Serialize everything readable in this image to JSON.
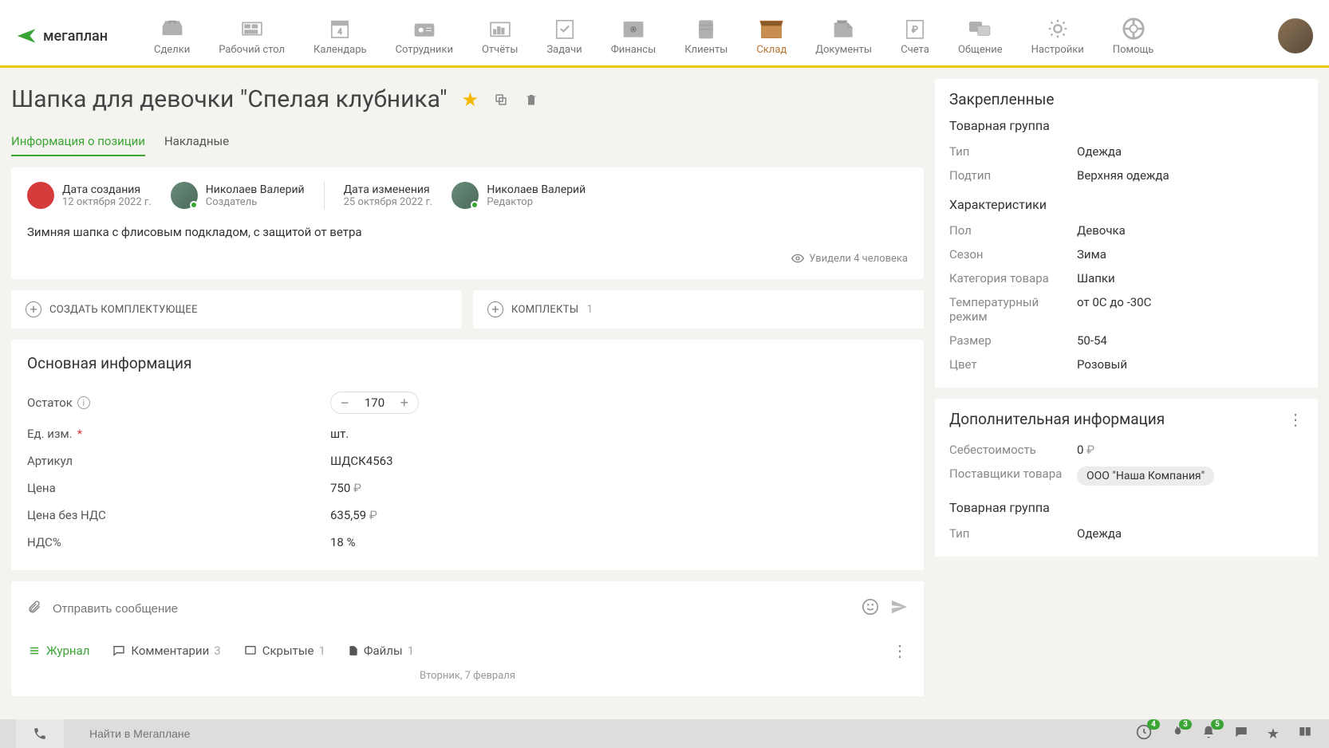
{
  "logo": "мегаплан",
  "nav": [
    {
      "label": "Сделки"
    },
    {
      "label": "Рабочий стол"
    },
    {
      "label": "Календарь"
    },
    {
      "label": "Сотрудники"
    },
    {
      "label": "Отчёты"
    },
    {
      "label": "Задачи"
    },
    {
      "label": "Финансы"
    },
    {
      "label": "Клиенты"
    },
    {
      "label": "Склад",
      "active": true
    },
    {
      "label": "Документы"
    },
    {
      "label": "Счета"
    },
    {
      "label": "Общение"
    },
    {
      "label": "Настройки"
    },
    {
      "label": "Помощь"
    }
  ],
  "page": {
    "title": "Шапка для девочки \"Спелая клубника\"",
    "tabs": [
      {
        "label": "Информация о позиции",
        "active": true
      },
      {
        "label": "Накладные"
      }
    ]
  },
  "meta": {
    "created_label": "Дата создания",
    "created_date": "12 октября 2022 г.",
    "creator_name": "Николаев Валерий",
    "creator_role": "Создатель",
    "modified_label": "Дата изменения",
    "modified_date": "25 октября 2022 г.",
    "editor_name": "Николаев Валерий",
    "editor_role": "Редактор",
    "description": "Зимняя шапка с флисовым подкладом, с защитой от ветра",
    "views": "Увидели 4 человека"
  },
  "actions": {
    "create_component": "СОЗДАТЬ КОМПЛЕКТУЮЩЕЕ",
    "kits": "КОМПЛЕКТЫ",
    "kits_count": "1"
  },
  "main_info": {
    "title": "Основная информация",
    "rows": {
      "balance_label": "Остаток",
      "balance_value": "170",
      "unit_label": "Ед. изм.",
      "unit_value": "шт.",
      "sku_label": "Артикул",
      "sku_value": "ШДСК4563",
      "price_label": "Цена",
      "price_value": "750",
      "price_novat_label": "Цена без НДС",
      "price_novat_value": "635,59",
      "vat_label": "НДС%",
      "vat_value": "18 %"
    }
  },
  "compose": {
    "placeholder": "Отправить сообщение"
  },
  "subtabs": {
    "journal": "Журнал",
    "comments": "Комментарии",
    "comments_count": "3",
    "hidden": "Скрытые",
    "hidden_count": "1",
    "files": "Файлы",
    "files_count": "1",
    "date": "Вторник, 7 февраля"
  },
  "pinned": {
    "title": "Закрепленные",
    "group_title": "Товарная группа",
    "type_label": "Тип",
    "type_value": "Одежда",
    "subtype_label": "Подтип",
    "subtype_value": "Верхняя одежда",
    "chars_title": "Характеристики",
    "sex_label": "Пол",
    "sex_value": "Девочка",
    "season_label": "Сезон",
    "season_value": "Зима",
    "cat_label": "Категория товара",
    "cat_value": "Шапки",
    "temp_label": "Температурный режим",
    "temp_value": "от 0С до -30С",
    "size_label": "Размер",
    "size_value": "50-54",
    "color_label": "Цвет",
    "color_value": "Розовый"
  },
  "extra": {
    "title": "Дополнительная информация",
    "cost_label": "Себестоимость",
    "cost_value": "0",
    "suppliers_label": "Поставщики товара",
    "suppliers_value": "ООО \"Наша Компания\"",
    "group_title": "Товарная группа",
    "type_label": "Тип",
    "type_value": "Одежда"
  },
  "bottom": {
    "search_placeholder": "Найти в Мегаплане",
    "badge1": "4",
    "badge2": "3",
    "badge3": "5"
  }
}
